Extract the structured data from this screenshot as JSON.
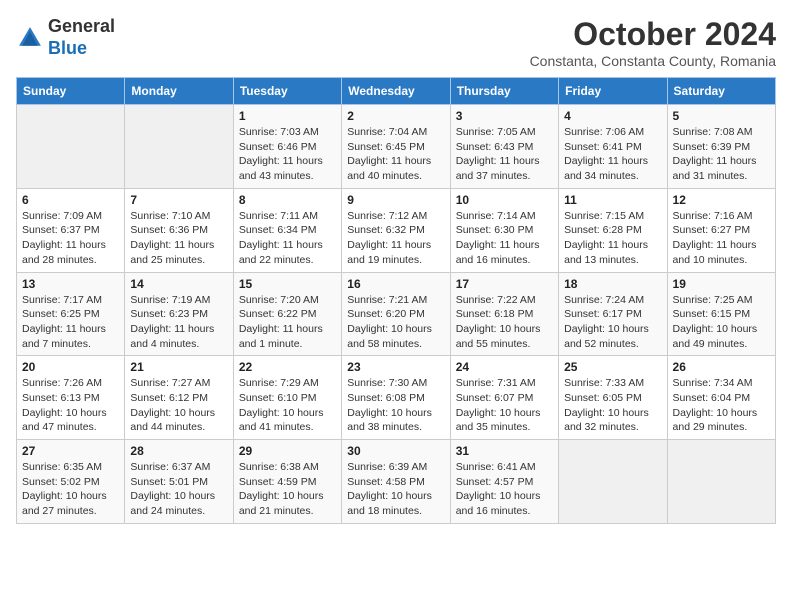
{
  "header": {
    "logo": {
      "line1": "General",
      "line2": "Blue"
    },
    "title": "October 2024",
    "subtitle": "Constanta, Constanta County, Romania"
  },
  "calendar": {
    "weekdays": [
      "Sunday",
      "Monday",
      "Tuesday",
      "Wednesday",
      "Thursday",
      "Friday",
      "Saturday"
    ],
    "weeks": [
      [
        {
          "day": null,
          "detail": null
        },
        {
          "day": null,
          "detail": null
        },
        {
          "day": "1",
          "detail": "Sunrise: 7:03 AM\nSunset: 6:46 PM\nDaylight: 11 hours and 43 minutes."
        },
        {
          "day": "2",
          "detail": "Sunrise: 7:04 AM\nSunset: 6:45 PM\nDaylight: 11 hours and 40 minutes."
        },
        {
          "day": "3",
          "detail": "Sunrise: 7:05 AM\nSunset: 6:43 PM\nDaylight: 11 hours and 37 minutes."
        },
        {
          "day": "4",
          "detail": "Sunrise: 7:06 AM\nSunset: 6:41 PM\nDaylight: 11 hours and 34 minutes."
        },
        {
          "day": "5",
          "detail": "Sunrise: 7:08 AM\nSunset: 6:39 PM\nDaylight: 11 hours and 31 minutes."
        }
      ],
      [
        {
          "day": "6",
          "detail": "Sunrise: 7:09 AM\nSunset: 6:37 PM\nDaylight: 11 hours and 28 minutes."
        },
        {
          "day": "7",
          "detail": "Sunrise: 7:10 AM\nSunset: 6:36 PM\nDaylight: 11 hours and 25 minutes."
        },
        {
          "day": "8",
          "detail": "Sunrise: 7:11 AM\nSunset: 6:34 PM\nDaylight: 11 hours and 22 minutes."
        },
        {
          "day": "9",
          "detail": "Sunrise: 7:12 AM\nSunset: 6:32 PM\nDaylight: 11 hours and 19 minutes."
        },
        {
          "day": "10",
          "detail": "Sunrise: 7:14 AM\nSunset: 6:30 PM\nDaylight: 11 hours and 16 minutes."
        },
        {
          "day": "11",
          "detail": "Sunrise: 7:15 AM\nSunset: 6:28 PM\nDaylight: 11 hours and 13 minutes."
        },
        {
          "day": "12",
          "detail": "Sunrise: 7:16 AM\nSunset: 6:27 PM\nDaylight: 11 hours and 10 minutes."
        }
      ],
      [
        {
          "day": "13",
          "detail": "Sunrise: 7:17 AM\nSunset: 6:25 PM\nDaylight: 11 hours and 7 minutes."
        },
        {
          "day": "14",
          "detail": "Sunrise: 7:19 AM\nSunset: 6:23 PM\nDaylight: 11 hours and 4 minutes."
        },
        {
          "day": "15",
          "detail": "Sunrise: 7:20 AM\nSunset: 6:22 PM\nDaylight: 11 hours and 1 minute."
        },
        {
          "day": "16",
          "detail": "Sunrise: 7:21 AM\nSunset: 6:20 PM\nDaylight: 10 hours and 58 minutes."
        },
        {
          "day": "17",
          "detail": "Sunrise: 7:22 AM\nSunset: 6:18 PM\nDaylight: 10 hours and 55 minutes."
        },
        {
          "day": "18",
          "detail": "Sunrise: 7:24 AM\nSunset: 6:17 PM\nDaylight: 10 hours and 52 minutes."
        },
        {
          "day": "19",
          "detail": "Sunrise: 7:25 AM\nSunset: 6:15 PM\nDaylight: 10 hours and 49 minutes."
        }
      ],
      [
        {
          "day": "20",
          "detail": "Sunrise: 7:26 AM\nSunset: 6:13 PM\nDaylight: 10 hours and 47 minutes."
        },
        {
          "day": "21",
          "detail": "Sunrise: 7:27 AM\nSunset: 6:12 PM\nDaylight: 10 hours and 44 minutes."
        },
        {
          "day": "22",
          "detail": "Sunrise: 7:29 AM\nSunset: 6:10 PM\nDaylight: 10 hours and 41 minutes."
        },
        {
          "day": "23",
          "detail": "Sunrise: 7:30 AM\nSunset: 6:08 PM\nDaylight: 10 hours and 38 minutes."
        },
        {
          "day": "24",
          "detail": "Sunrise: 7:31 AM\nSunset: 6:07 PM\nDaylight: 10 hours and 35 minutes."
        },
        {
          "day": "25",
          "detail": "Sunrise: 7:33 AM\nSunset: 6:05 PM\nDaylight: 10 hours and 32 minutes."
        },
        {
          "day": "26",
          "detail": "Sunrise: 7:34 AM\nSunset: 6:04 PM\nDaylight: 10 hours and 29 minutes."
        }
      ],
      [
        {
          "day": "27",
          "detail": "Sunrise: 6:35 AM\nSunset: 5:02 PM\nDaylight: 10 hours and 27 minutes."
        },
        {
          "day": "28",
          "detail": "Sunrise: 6:37 AM\nSunset: 5:01 PM\nDaylight: 10 hours and 24 minutes."
        },
        {
          "day": "29",
          "detail": "Sunrise: 6:38 AM\nSunset: 4:59 PM\nDaylight: 10 hours and 21 minutes."
        },
        {
          "day": "30",
          "detail": "Sunrise: 6:39 AM\nSunset: 4:58 PM\nDaylight: 10 hours and 18 minutes."
        },
        {
          "day": "31",
          "detail": "Sunrise: 6:41 AM\nSunset: 4:57 PM\nDaylight: 10 hours and 16 minutes."
        },
        {
          "day": null,
          "detail": null
        },
        {
          "day": null,
          "detail": null
        }
      ]
    ]
  }
}
